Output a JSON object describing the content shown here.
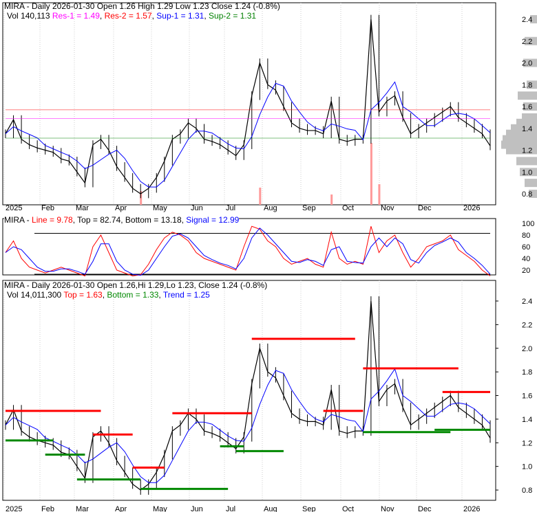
{
  "colors": {
    "price": "#000000",
    "res1": "#ff00ff",
    "res2": "#ff0000",
    "sup1": "#0000ff",
    "sup2": "#008000",
    "volume": "#ff9999",
    "profile": "#c0c0c0",
    "signal": "#0000ff",
    "line": "#ff0000"
  },
  "panel1": {
    "ticker": "MIRA",
    "line1": "MIRA - Daily 2026-01-30 Open 1.26  High 1.29  Low 1.23  Close 1.24 (-0.8%)",
    "vol": "Vol 140,113",
    "res1": "Res-1 = 1.49",
    "res2": "Res-2 = 1.57",
    "sup1": "Sup-1 = 1.31",
    "sup2": "Sup-2 = 1.31"
  },
  "panel2": {
    "prefix": "MIRA - ",
    "line": "Line = 9.78",
    "rest": ", Top = 82.74, Bottom = 13.18, ",
    "signal": "Signal = 12.99"
  },
  "panel3": {
    "line1": "MIRA - Daily 2026-01-30 Open 1.26,Hi 1.29,Lo 1.23, Close 1.24 (-0.8%)",
    "vol": "Vol 14,011,300",
    "top": "Top = 1.63",
    "bottom": "Bottom = 1.33",
    "trend": "Trend = 1.25"
  },
  "chart_data": {
    "type": "line",
    "x_labels": [
      "2025",
      "Feb",
      "Mar",
      "Apr",
      "May",
      "Jun",
      "Jul",
      "Aug",
      "Sep",
      "Oct",
      "Nov",
      "Dec",
      "2026"
    ],
    "price_ticks": [
      "2.4",
      "2.2",
      "2.0",
      "1.8",
      "1.6",
      "1.4",
      "1.2",
      "1.0",
      "0.8"
    ],
    "osc_ticks": [
      "100",
      "80",
      "60",
      "40",
      "20"
    ],
    "ylim": [
      0.75,
      2.45
    ],
    "close": [
      1.35,
      1.48,
      1.3,
      1.25,
      1.22,
      1.2,
      1.18,
      1.12,
      1.1,
      1.0,
      0.9,
      1.25,
      1.3,
      1.2,
      1.05,
      0.95,
      0.85,
      0.8,
      0.85,
      0.95,
      1.1,
      1.3,
      1.35,
      1.45,
      1.4,
      1.3,
      1.28,
      1.25,
      1.2,
      1.15,
      1.25,
      1.7,
      2.0,
      1.8,
      1.75,
      1.6,
      1.45,
      1.4,
      1.38,
      1.38,
      1.35,
      1.65,
      1.3,
      1.28,
      1.3,
      1.3,
      2.4,
      1.55,
      1.65,
      1.7,
      1.5,
      1.35,
      1.4,
      1.45,
      1.5,
      1.55,
      1.6,
      1.5,
      1.45,
      1.4,
      1.35,
      1.24
    ],
    "oscillator": [
      50,
      70,
      40,
      25,
      20,
      15,
      20,
      25,
      20,
      15,
      10,
      60,
      80,
      50,
      20,
      15,
      10,
      12,
      30,
      55,
      75,
      85,
      80,
      70,
      50,
      40,
      35,
      30,
      25,
      20,
      60,
      95,
      90,
      70,
      60,
      40,
      30,
      35,
      40,
      30,
      25,
      85,
      40,
      30,
      35,
      30,
      95,
      50,
      70,
      80,
      50,
      25,
      40,
      60,
      65,
      70,
      80,
      55,
      45,
      35,
      20,
      10
    ],
    "signal": [
      50,
      60,
      55,
      40,
      25,
      18,
      18,
      22,
      22,
      18,
      13,
      35,
      65,
      65,
      35,
      20,
      13,
      11,
      20,
      40,
      60,
      78,
      82,
      75,
      60,
      45,
      38,
      32,
      28,
      22,
      40,
      75,
      92,
      80,
      65,
      50,
      35,
      33,
      38,
      35,
      28,
      55,
      60,
      35,
      33,
      32,
      60,
      75,
      60,
      75,
      65,
      38,
      32,
      50,
      62,
      68,
      75,
      68,
      50,
      40,
      28,
      13
    ],
    "resistance_segments": [
      [
        0,
        12,
        1.47
      ],
      [
        11,
        16,
        1.27
      ],
      [
        16,
        20,
        0.99
      ],
      [
        21,
        31,
        1.45
      ],
      [
        31,
        44,
        2.08
      ],
      [
        40,
        45,
        1.47
      ],
      [
        45,
        57,
        1.83
      ],
      [
        55,
        61,
        1.63
      ]
    ],
    "support_segments": [
      [
        0,
        6,
        1.22
      ],
      [
        5,
        10,
        1.1
      ],
      [
        9,
        17,
        0.89
      ],
      [
        17,
        28,
        0.81
      ],
      [
        27,
        30,
        1.17
      ],
      [
        29,
        35,
        1.13
      ],
      [
        45,
        56,
        1.29
      ],
      [
        54,
        61,
        1.31
      ]
    ]
  }
}
